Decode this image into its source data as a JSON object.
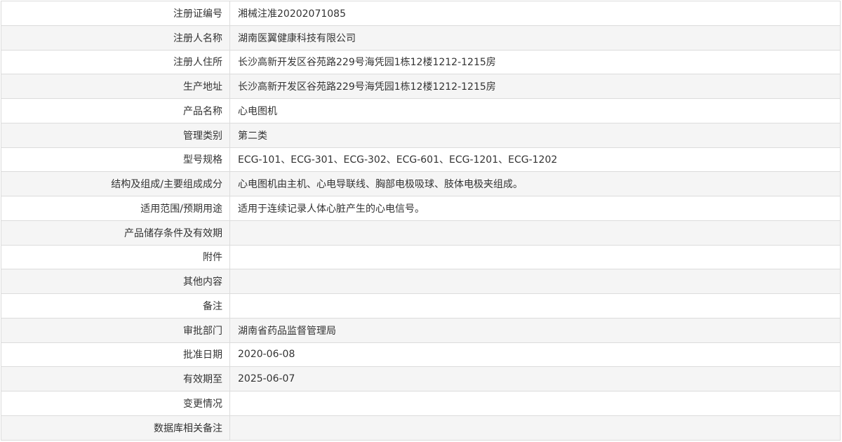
{
  "rows": [
    {
      "label": "注册证编号",
      "value": "湘械注准20202071085"
    },
    {
      "label": "注册人名称",
      "value": "湖南医翼健康科技有限公司"
    },
    {
      "label": "注册人住所",
      "value": "长沙高新开发区谷苑路229号海凭园1栋12楼1212-1215房"
    },
    {
      "label": "生产地址",
      "value": "长沙高新开发区谷苑路229号海凭园1栋12楼1212-1215房"
    },
    {
      "label": "产品名称",
      "value": "心电图机"
    },
    {
      "label": "管理类别",
      "value": "第二类"
    },
    {
      "label": "型号规格",
      "value": "ECG-101、ECG-301、ECG-302、ECG-601、ECG-1201、ECG-1202"
    },
    {
      "label": "结构及组成/主要组成成分",
      "value": "心电图机由主机、心电导联线、胸部电极吸球、肢体电极夹组成。"
    },
    {
      "label": "适用范围/预期用途",
      "value": "适用于连续记录人体心脏产生的心电信号。"
    },
    {
      "label": "产品储存条件及有效期",
      "value": ""
    },
    {
      "label": "附件",
      "value": ""
    },
    {
      "label": "其他内容",
      "value": ""
    },
    {
      "label": "备注",
      "value": ""
    },
    {
      "label": "审批部门",
      "value": "湖南省药品监督管理局"
    },
    {
      "label": "批准日期",
      "value": "2020-06-08"
    },
    {
      "label": "有效期至",
      "value": "2025-06-07"
    },
    {
      "label": "变更情况",
      "value": ""
    },
    {
      "label": "数据库相关备注",
      "value": ""
    }
  ]
}
